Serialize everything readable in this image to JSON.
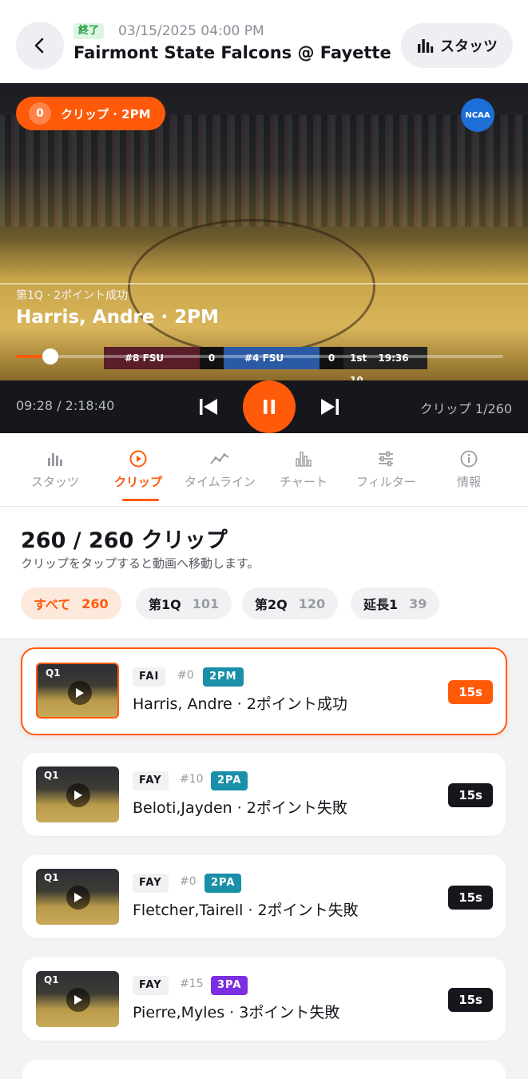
{
  "header": {
    "status": "終了",
    "date": "03/15/2025 04:00 PM",
    "title": "Fairmont State Falcons @ Fayetteville",
    "stats_label": "スタッツ"
  },
  "video": {
    "clip_index": "0",
    "clip_label": "クリップ · 2PM",
    "logo": "NCAA",
    "play_desc": "第1Q · 2ポイント成功",
    "player": "Harris, Andre · 2PM",
    "score": {
      "team1": "#8 FSU",
      "score1": "0",
      "team2": "#4 FSU",
      "score2": "0",
      "clock": "1st 19:36 10"
    },
    "progress": 0.07
  },
  "controls": {
    "time": "09:28 / 2:18:40",
    "clip_counter": "クリップ 1/260"
  },
  "tabs": [
    {
      "label": "スタッツ",
      "icon": "bar-chart-icon"
    },
    {
      "label": "クリップ",
      "icon": "play-circle-icon"
    },
    {
      "label": "タイムライン",
      "icon": "trend-line-icon"
    },
    {
      "label": "チャート",
      "icon": "column-chart-icon"
    },
    {
      "label": "フィルター",
      "icon": "sliders-icon"
    },
    {
      "label": "情報",
      "icon": "info-icon"
    }
  ],
  "clips_header": {
    "count": "260 / 260 クリップ",
    "subtitle": "クリップをタップすると動画へ移動します。",
    "filters": [
      {
        "label": "すべて",
        "count": "260"
      },
      {
        "label": "第1Q",
        "count": "101"
      },
      {
        "label": "第2Q",
        "count": "120"
      },
      {
        "label": "延長1",
        "count": "39"
      }
    ]
  },
  "clips": [
    {
      "quarter": "Q1",
      "team": "FAI",
      "jersey": "#0",
      "type": "2PM",
      "type_color": "#1a8fa8",
      "name": "Harris, Andre · 2ポイント成功",
      "duration": "15s"
    },
    {
      "quarter": "Q1",
      "team": "FAY",
      "jersey": "#10",
      "type": "2PA",
      "type_color": "#1a8fa8",
      "name": "Beloti,Jayden · 2ポイント失敗",
      "duration": "15s"
    },
    {
      "quarter": "Q1",
      "team": "FAY",
      "jersey": "#0",
      "type": "2PA",
      "type_color": "#1a8fa8",
      "name": "Fletcher,Tairell · 2ポイント失敗",
      "duration": "15s"
    },
    {
      "quarter": "Q1",
      "team": "FAY",
      "jersey": "#15",
      "type": "3PA",
      "type_color": "#7b2fe0",
      "name": "Pierre,Myles · 3ポイント失敗",
      "duration": "15s"
    }
  ],
  "colors": {
    "accent": "#ff5a0a",
    "status_green": "#1f9d3e",
    "dark": "#15171c"
  }
}
